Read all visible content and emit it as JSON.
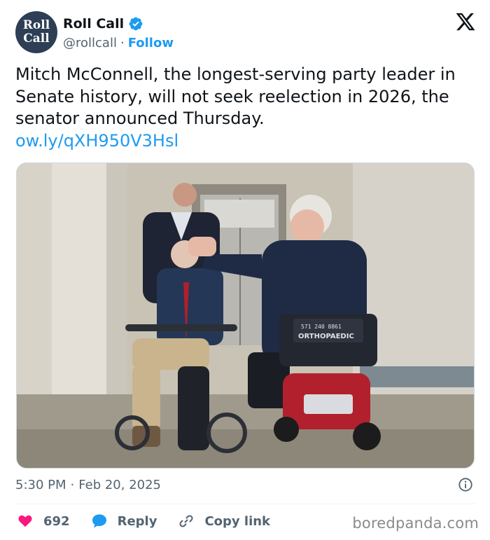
{
  "account": {
    "avatar_line1": "Roll",
    "avatar_line2": "Call",
    "display_name": "Roll Call",
    "handle": "@rollcall",
    "separator": "·",
    "follow_label": "Follow",
    "avatar_color": "#2d3e55",
    "verified_color": "#1d9bf0",
    "verified_icon": "verified-badge-icon"
  },
  "platform_icon": "x-logo-icon",
  "tweet": {
    "text": "Mitch McConnell, the longest-serving party leader in Senate history, will not seek reelection in 2026, the senator announced Thursday.",
    "link": "ow.ly/qXH950V3Hsl",
    "link_color": "#1d9bf0"
  },
  "media": {
    "sign_line1": "571 240 8861",
    "sign_line2": "ORTHOPAEDIC"
  },
  "meta": {
    "time": "5:30 PM",
    "separator": "·",
    "date": "Feb 20, 2025",
    "info_icon": "info-icon"
  },
  "actions": {
    "like_count": "692",
    "like_icon": "heart-icon",
    "like_color": "#f91880",
    "reply_label": "Reply",
    "reply_icon": "speech-bubble-icon",
    "reply_color": "#1d9bf0",
    "copy_label": "Copy link",
    "copy_icon": "link-icon"
  },
  "watermark": "boredpanda.com"
}
